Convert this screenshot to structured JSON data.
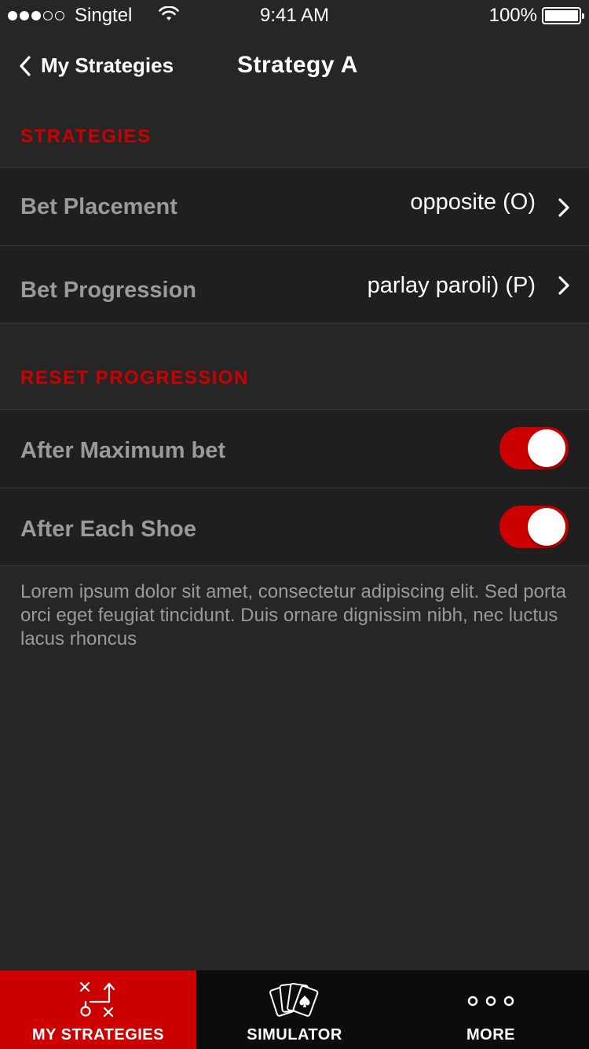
{
  "status_bar": {
    "carrier": "Singtel",
    "time": "9:41 AM",
    "battery": "100%"
  },
  "nav": {
    "back_label": "My Strategies",
    "title": "Strategy A"
  },
  "sections": {
    "strategies_header": "STRATEGIES",
    "reset_header": "RESET PROGRESSION"
  },
  "strategy_rows": [
    {
      "label": "Bet Placement",
      "value": "opposite (O)"
    },
    {
      "label": "Bet Progression",
      "value": "parlay paroli) (P)"
    }
  ],
  "reset_rows": [
    {
      "label": "After Maximum bet",
      "on": true
    },
    {
      "label": "After Each Shoe",
      "on": true
    }
  ],
  "description": "Lorem ipsum dolor sit amet, consectetur adipiscing elit. Sed porta orci eget feugiat tincidunt. Duis ornare dignissim nibh, nec luctus lacus rhoncus",
  "tabs": [
    {
      "label": "MY STRATEGIES",
      "icon": "strategy-play-icon",
      "active": true
    },
    {
      "label": "SIMULATOR",
      "icon": "playing-cards-icon",
      "active": false
    },
    {
      "label": "MORE",
      "icon": "more-dots-icon",
      "active": false
    }
  ],
  "colors": {
    "accent": "#cc0000",
    "background": "#262626",
    "row_background": "#1f1f1f",
    "tab_bar": "#0c0c0c"
  }
}
